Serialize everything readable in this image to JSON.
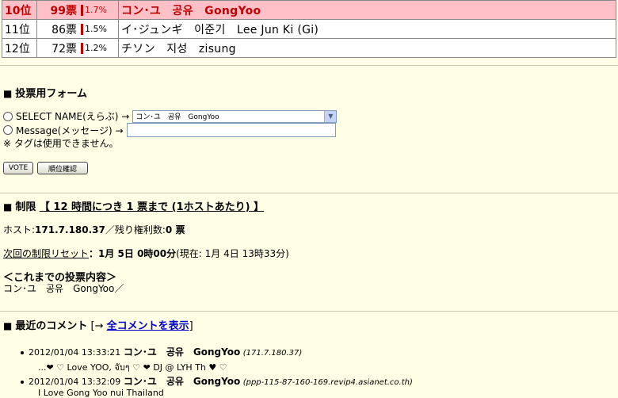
{
  "ranking": [
    {
      "rank": "10位",
      "votes": "99票",
      "pct": "1.7%",
      "name": "コン･ユ　공유　GongYoo",
      "highlight": true
    },
    {
      "rank": "11位",
      "votes": "86票",
      "pct": "1.5%",
      "name": "イ･ジュンギ　이준기　Lee Jun Ki (Gi)",
      "highlight": false
    },
    {
      "rank": "12位",
      "votes": "72票",
      "pct": "1.2%",
      "name": "チソン　지성　zisung",
      "highlight": false
    }
  ],
  "vote_form": {
    "heading": "投票用フォーム",
    "select_label": "SELECT NAME(えらぶ) →",
    "select_value": "コン･ユ　공유　GongYoo",
    "message_label": "Message(メッセージ) →",
    "message_value": "",
    "tag_note": "※ タグは使用できません。",
    "vote_button": "VOTE",
    "rank_button": "順位確認"
  },
  "limit": {
    "label": "制限",
    "rule": "【 12 時間につき 1 票まで (1ホストあたり) 】",
    "host_label": "ホスト:",
    "host_value": "171.7.180.37",
    "remaining_label": "／残り権利数:",
    "remaining_value": "0 票",
    "reset_label": "次回の制限リセット",
    "reset_value": "：1月 5日 0時00分",
    "current": "(現在: 1月 4日 13時33分)",
    "history_title": "＜これまでの投票内容＞",
    "history_value": "コン･ユ　공유　GongYoo／"
  },
  "comments": {
    "label": "最近のコメント",
    "link_prefix": "[→ ",
    "link_text": "全コメントを表示",
    "link_suffix": "]",
    "items": [
      {
        "time": "2012/01/04 13:33:21",
        "name": "コン･ユ　공유　GongYoo",
        "host": "(171.7.180.37)",
        "body": "...❤ ♡ Love YOO, จับๆ ♡ ❤ DJ @ LYH Th ♥ ♡"
      },
      {
        "time": "2012/01/04 13:32:09",
        "name": "コン･ユ　공유　GongYoo",
        "host": "(ppp-115-87-160-169.revip4.asianet.co.th)",
        "body": "I Love Gong Yoo nui Thailand"
      }
    ]
  }
}
